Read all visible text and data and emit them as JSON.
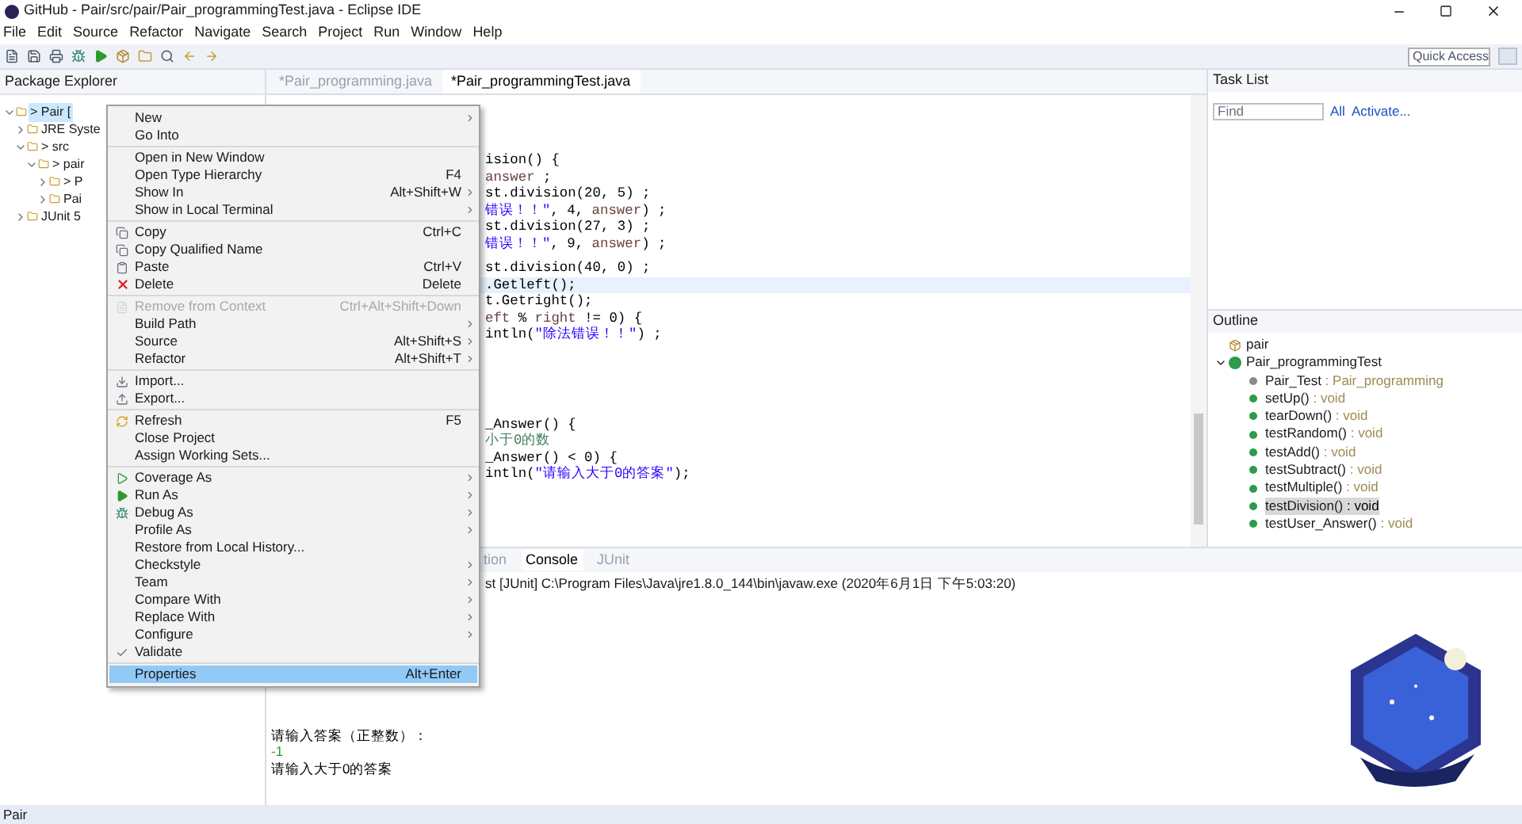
{
  "window": {
    "title": "GitHub - Pair/src/pair/Pair_programmingTest.java - Eclipse IDE"
  },
  "menu_bar": [
    "File",
    "Edit",
    "Source",
    "Refactor",
    "Navigate",
    "Search",
    "Project",
    "Run",
    "Window",
    "Help"
  ],
  "quick_access": {
    "placeholder": "Quick Access"
  },
  "package_explorer": {
    "title": "Package Explorer",
    "tree": [
      {
        "label": "> Pair [",
        "expanded": true,
        "selected": true,
        "children": [
          {
            "label": "JRE Syste",
            "expanded": false,
            "selected": false
          },
          {
            "label": "> src",
            "expanded": true,
            "selected": false,
            "children": [
              {
                "label": "> pair",
                "expanded": true,
                "selected": false,
                "children": [
                  {
                    "label": "> P",
                    "expanded": false,
                    "selected": false
                  },
                  {
                    "label": "Pai",
                    "expanded": false,
                    "selected": false
                  }
                ]
              }
            ]
          },
          {
            "label": "JUnit 5",
            "expanded": false,
            "selected": false
          }
        ]
      }
    ]
  },
  "editor": {
    "tabs": [
      {
        "label": "*Pair_programming.java",
        "selected": false
      },
      {
        "label": "*Pair_programmingTest.java",
        "selected": true
      }
    ],
    "blocks": [
      [
        {
          "highlighted": false,
          "segments": [
            {
              "text": "ision() {",
              "kind": "plain"
            }
          ]
        },
        {
          "highlighted": false,
          "segments": [
            {
              "text": "answer",
              "kind": "var"
            },
            {
              "text": " ;",
              "kind": "plain"
            }
          ]
        },
        {
          "highlighted": false,
          "segments": [
            {
              "text": "st.division(20, 5) ;",
              "kind": "plain"
            }
          ]
        },
        {
          "highlighted": false,
          "segments": [
            {
              "text": "错误！！\"",
              "kind": "string"
            },
            {
              "text": ", 4, ",
              "kind": "plain"
            },
            {
              "text": "answer",
              "kind": "var"
            },
            {
              "text": ") ;",
              "kind": "plain"
            }
          ]
        },
        {
          "highlighted": false,
          "segments": [
            {
              "text": "st.division(27, 3) ;",
              "kind": "plain"
            }
          ]
        },
        {
          "highlighted": false,
          "segments": [
            {
              "text": "错误！！\"",
              "kind": "string"
            },
            {
              "text": ", 9, ",
              "kind": "plain"
            },
            {
              "text": "answer",
              "kind": "var"
            },
            {
              "text": ") ;",
              "kind": "plain"
            }
          ]
        }
      ],
      [
        {
          "highlighted": false,
          "segments": [
            {
              "text": "st.division(40, 0) ;",
              "kind": "plain"
            }
          ]
        },
        {
          "highlighted": true,
          "segments": [
            {
              "text": ".Getleft();",
              "kind": "plain"
            }
          ]
        },
        {
          "highlighted": false,
          "segments": [
            {
              "text": "t.Getright();",
              "kind": "plain"
            }
          ]
        },
        {
          "highlighted": false,
          "segments": [
            {
              "text": "eft",
              "kind": "var"
            },
            {
              "text": " % ",
              "kind": "plain"
            },
            {
              "text": "right",
              "kind": "var"
            },
            {
              "text": " != 0) {",
              "kind": "plain"
            }
          ]
        },
        {
          "highlighted": false,
          "segments": [
            {
              "text": "intln(",
              "kind": "plain"
            },
            {
              "text": "\"除法错误！！\"",
              "kind": "string"
            },
            {
              "text": ") ;",
              "kind": "plain"
            }
          ]
        }
      ],
      [
        {
          "highlighted": false,
          "segments": [
            {
              "text": "_Answer() {",
              "kind": "plain"
            }
          ]
        },
        {
          "highlighted": false,
          "segments": [
            {
              "text": "小于0的数",
              "kind": "comment"
            }
          ]
        },
        {
          "highlighted": false,
          "segments": [
            {
              "text": "_Answer() < 0) {",
              "kind": "plain"
            }
          ]
        },
        {
          "highlighted": false,
          "segments": [
            {
              "text": "intln(",
              "kind": "plain"
            },
            {
              "text": "\"请输入大于0的答案\"",
              "kind": "string"
            },
            {
              "text": ");",
              "kind": "plain"
            }
          ]
        }
      ]
    ]
  },
  "task_list": {
    "title": "Task List",
    "find": {
      "placeholder": "Find"
    },
    "links": [
      "All",
      "Activate..."
    ]
  },
  "outline": {
    "title": "Outline",
    "items": [
      {
        "name": "pair",
        "kind": "package",
        "selected": false
      },
      {
        "name": "Pair_programmingTest",
        "kind": "class",
        "expanded": true,
        "selected": false,
        "children": [
          {
            "name": "Pair_Test",
            "type": " : Pair_programming",
            "kind": "field",
            "selected": false
          },
          {
            "name": "setUp()",
            "type": " : void",
            "kind": "method",
            "selected": false
          },
          {
            "name": "tearDown()",
            "type": " : void",
            "kind": "method",
            "selected": false
          },
          {
            "name": "testRandom()",
            "type": " : void",
            "kind": "method",
            "selected": false
          },
          {
            "name": "testAdd()",
            "type": " : void",
            "kind": "method",
            "selected": false
          },
          {
            "name": "testSubtract()",
            "type": " : void",
            "kind": "method",
            "selected": false
          },
          {
            "name": "testMultiple()",
            "type": " : void",
            "kind": "method",
            "selected": false
          },
          {
            "name": "testDivision()",
            "type": " : void",
            "kind": "method",
            "selected": true
          },
          {
            "name": "testUser_Answer()",
            "type": " : void",
            "kind": "method",
            "selected": false
          }
        ]
      }
    ]
  },
  "console": {
    "tabs": [
      {
        "label": "tion",
        "selected": false
      },
      {
        "label": "Console",
        "selected": true
      },
      {
        "label": "JUnit",
        "selected": false
      }
    ],
    "header": "st [JUnit] C:\\Program Files\\Java\\jre1.8.0_144\\bin\\javaw.exe (2020年6月1日 下午5:03:20)",
    "output": [
      {
        "text": "请输入答案（正整数）：",
        "kind": "output"
      },
      {
        "text": "-1",
        "kind": "input"
      },
      {
        "text": "请输入大于0的答案",
        "kind": "output"
      }
    ]
  },
  "context_menu": [
    [
      {
        "label": "New",
        "submenu": true,
        "disabled": false,
        "selected": false
      },
      {
        "label": "Go Into",
        "submenu": false,
        "disabled": false,
        "selected": false
      }
    ],
    [
      {
        "label": "Open in New Window",
        "submenu": false,
        "disabled": false,
        "selected": false
      },
      {
        "label": "Open Type Hierarchy",
        "shortcut": "F4",
        "submenu": false,
        "disabled": false,
        "selected": false
      },
      {
        "label": "Show In",
        "shortcut": "Alt+Shift+W",
        "submenu": true,
        "disabled": false,
        "selected": false
      },
      {
        "label": "Show in Local Terminal",
        "submenu": true,
        "disabled": false,
        "selected": false
      }
    ],
    [
      {
        "label": "Copy",
        "shortcut": "Ctrl+C",
        "submenu": false,
        "disabled": false,
        "selected": false
      },
      {
        "label": "Copy Qualified Name",
        "submenu": false,
        "disabled": false,
        "selected": false
      },
      {
        "label": "Paste",
        "shortcut": "Ctrl+V",
        "submenu": false,
        "disabled": false,
        "selected": false
      },
      {
        "label": "Delete",
        "shortcut": "Delete",
        "submenu": false,
        "disabled": false,
        "selected": false
      }
    ],
    [
      {
        "label": "Remove from Context",
        "shortcut": "Ctrl+Alt+Shift+Down",
        "submenu": false,
        "disabled": true,
        "selected": false
      },
      {
        "label": "Build Path",
        "submenu": true,
        "disabled": false,
        "selected": false
      },
      {
        "label": "Source",
        "shortcut": "Alt+Shift+S",
        "submenu": true,
        "disabled": false,
        "selected": false
      },
      {
        "label": "Refactor",
        "shortcut": "Alt+Shift+T",
        "submenu": true,
        "disabled": false,
        "selected": false
      }
    ],
    [
      {
        "label": "Import...",
        "submenu": false,
        "disabled": false,
        "selected": false
      },
      {
        "label": "Export...",
        "submenu": false,
        "disabled": false,
        "selected": false
      }
    ],
    [
      {
        "label": "Refresh",
        "shortcut": "F5",
        "submenu": false,
        "disabled": false,
        "selected": false
      },
      {
        "label": "Close Project",
        "submenu": false,
        "disabled": false,
        "selected": false
      },
      {
        "label": "Assign Working Sets...",
        "submenu": false,
        "disabled": false,
        "selected": false
      }
    ],
    [
      {
        "label": "Coverage As",
        "submenu": true,
        "disabled": false,
        "selected": false
      },
      {
        "label": "Run As",
        "submenu": true,
        "disabled": false,
        "selected": false
      },
      {
        "label": "Debug As",
        "submenu": true,
        "disabled": false,
        "selected": false
      },
      {
        "label": "Profile As",
        "submenu": true,
        "disabled": false,
        "selected": false
      },
      {
        "label": "Restore from Local History...",
        "submenu": false,
        "disabled": false,
        "selected": false
      },
      {
        "label": "Checkstyle",
        "submenu": true,
        "disabled": false,
        "selected": false
      },
      {
        "label": "Team",
        "submenu": true,
        "disabled": false,
        "selected": false
      },
      {
        "label": "Compare With",
        "submenu": true,
        "disabled": false,
        "selected": false
      },
      {
        "label": "Replace With",
        "submenu": true,
        "disabled": false,
        "selected": false
      },
      {
        "label": "Configure",
        "submenu": true,
        "disabled": false,
        "selected": false
      },
      {
        "label": "Validate",
        "submenu": false,
        "disabled": false,
        "selected": false
      }
    ],
    [
      {
        "label": "Properties",
        "shortcut": "Alt+Enter",
        "submenu": false,
        "disabled": false,
        "selected": true
      }
    ]
  ],
  "status_bar": {
    "text": "Pair"
  }
}
